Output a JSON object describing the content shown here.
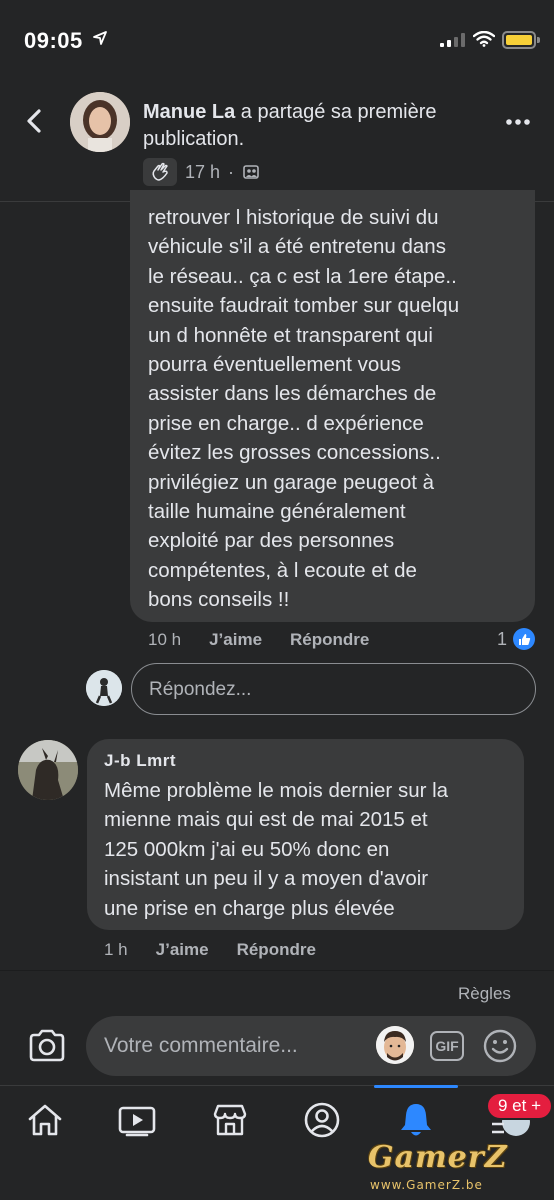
{
  "status_bar": {
    "time": "09:05"
  },
  "header": {
    "author": "Manue La",
    "action_text": " a partagé sa première publication.",
    "timestamp": "17 h",
    "separator": "·"
  },
  "comment1": {
    "lines": [
      "retrouver l historique de suivi du",
      "véhicule s'il a été entretenu dans",
      "le réseau.. ça c est la 1ere étape..",
      "ensuite faudrait tomber sur quelqu",
      "un d honnête et transparent qui",
      "pourra éventuellement vous",
      "assister dans les démarches de",
      "prise en charge.. d expérience",
      "évitez les grosses concessions..",
      "privilégiez un garage peugeot à",
      "taille humaine généralement",
      "exploité par des personnes",
      "compétentes, à l ecoute et de",
      "bons conseils !!"
    ],
    "time": "10 h",
    "like_label": "J’aime",
    "reply_label": "Répondre",
    "like_count": "1"
  },
  "reply_box": {
    "placeholder": "Répondez..."
  },
  "comment2": {
    "author": "J-b Lmrt",
    "lines": [
      "Même problème le mois dernier sur la",
      "mienne mais qui est de mai 2015 et",
      "125 000km j'ai eu 50% donc en",
      "insistant un peu il y a moyen d'avoir",
      "une prise en charge plus élevée"
    ],
    "time": "1 h",
    "like_label": "J’aime",
    "reply_label": "Répondre"
  },
  "composer": {
    "rules_label": "Règles",
    "placeholder": "Votre commentaire...",
    "gif_label": "GIF"
  },
  "tabbar": {
    "items": [
      {
        "icon": "home-icon"
      },
      {
        "icon": "video-icon"
      },
      {
        "icon": "marketplace-icon"
      },
      {
        "icon": "profile-icon"
      },
      {
        "icon": "bell-icon"
      },
      {
        "icon": "menu-icon"
      }
    ],
    "notification_badge": "9 et +"
  },
  "watermark": {
    "brand": "GamerZ",
    "url": "www.GamerZ.be"
  },
  "colors": {
    "accent": "#2d88ff",
    "background": "#242526",
    "bubble": "#3a3b3c",
    "badge": "#e41e3f"
  }
}
